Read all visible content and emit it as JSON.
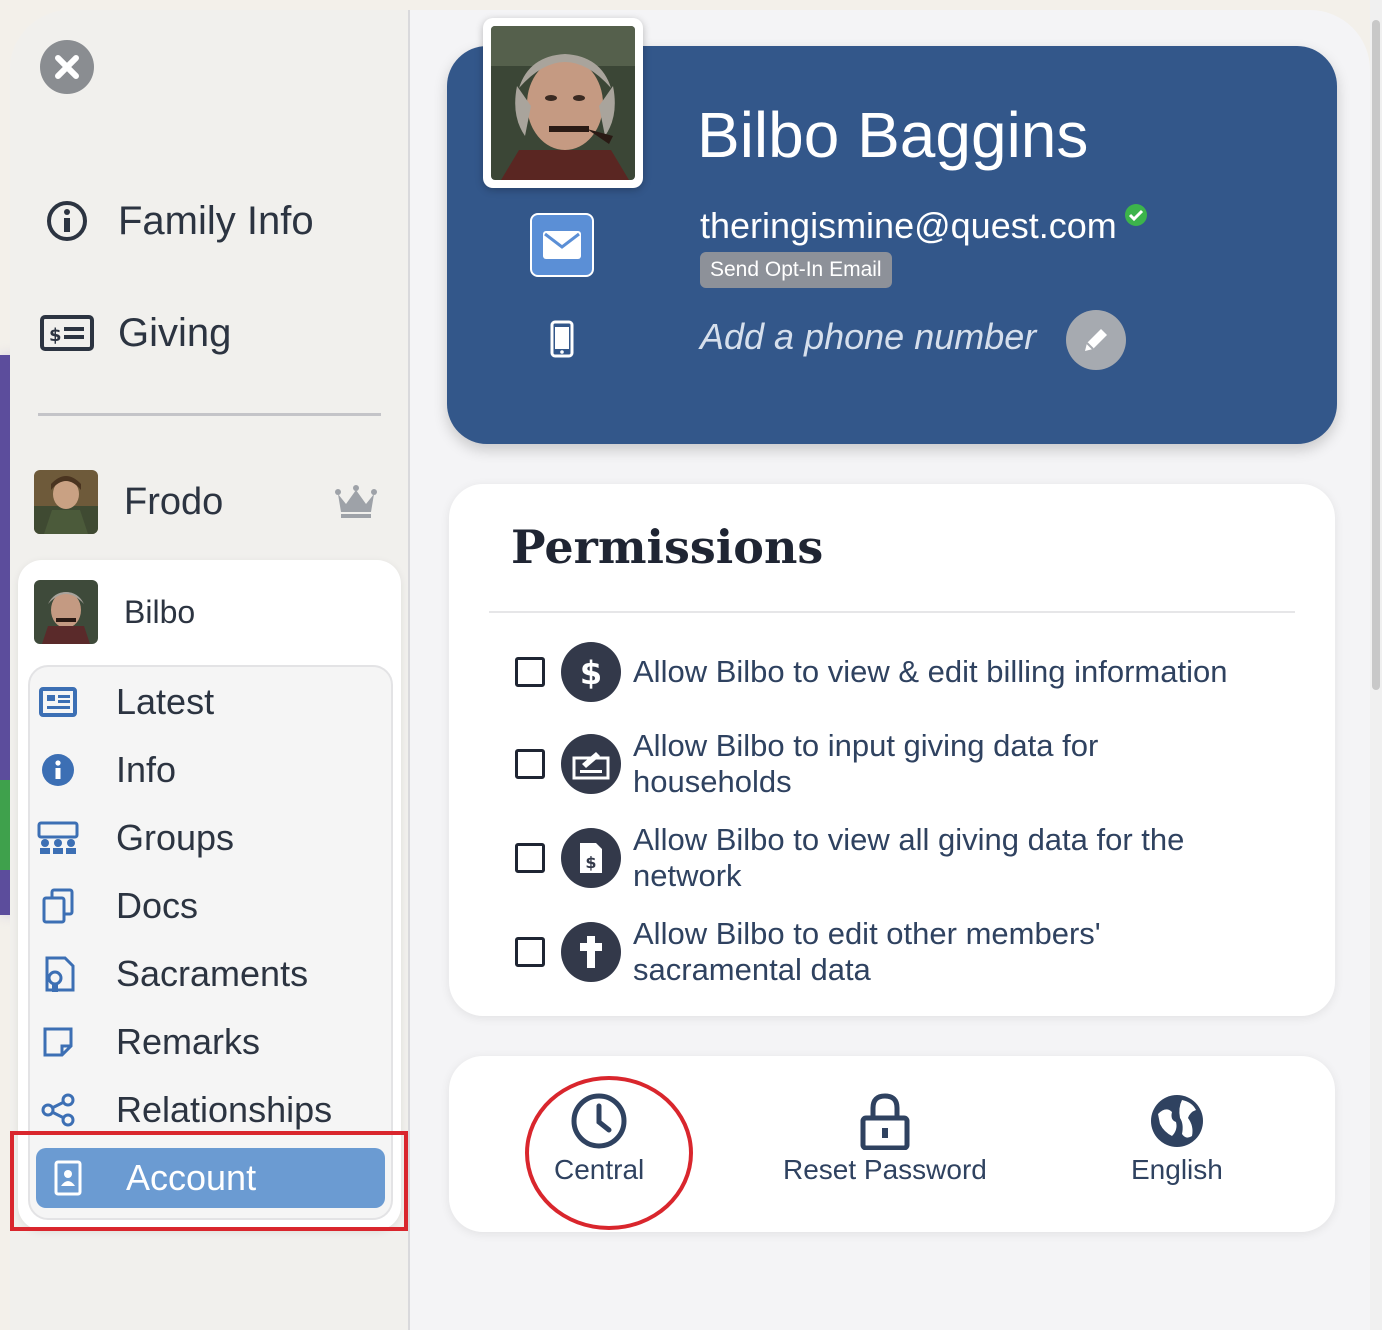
{
  "sidebar": {
    "top_nav": [
      {
        "label": "Family Info",
        "icon": "info-circle-icon"
      },
      {
        "label": "Giving",
        "icon": "money-card-icon"
      }
    ],
    "members": [
      {
        "name": "Frodo",
        "badge_icon": "crown-icon"
      },
      {
        "name": "Bilbo"
      }
    ],
    "submenu": [
      {
        "label": "Latest",
        "icon": "newspaper-icon"
      },
      {
        "label": "Info",
        "icon": "info-icon"
      },
      {
        "label": "Groups",
        "icon": "groups-icon"
      },
      {
        "label": "Docs",
        "icon": "docs-icon"
      },
      {
        "label": "Sacraments",
        "icon": "sacraments-icon"
      },
      {
        "label": "Remarks",
        "icon": "remarks-icon"
      },
      {
        "label": "Relationships",
        "icon": "share-icon"
      },
      {
        "label": "Account",
        "icon": "account-icon",
        "active": true
      }
    ]
  },
  "profile": {
    "name": "Bilbo Baggins",
    "email": "theringismine@quest.com",
    "email_verified": true,
    "optin_label": "Send Opt-In Email",
    "phone_placeholder": "Add a phone number"
  },
  "permissions": {
    "title": "Permissions",
    "items": [
      {
        "text": "Allow Bilbo to view & edit billing information",
        "icon": "dollar-icon",
        "checked": false
      },
      {
        "text": "Allow Bilbo to input giving data for households",
        "icon": "giving-input-icon",
        "checked": false
      },
      {
        "text": "Allow Bilbo to view all giving data for the network",
        "icon": "giving-report-icon",
        "checked": false
      },
      {
        "text": "Allow Bilbo to edit other members' sacramental data",
        "icon": "cross-icon",
        "checked": false
      }
    ]
  },
  "actions": [
    {
      "label": "Central",
      "icon": "clock-icon"
    },
    {
      "label": "Reset Password",
      "icon": "lock-icon"
    },
    {
      "label": "English",
      "icon": "globe-icon"
    }
  ],
  "colors": {
    "hero_bg": "#33578a",
    "active_item": "#6b9bd2",
    "highlight_red": "#d9262d"
  }
}
